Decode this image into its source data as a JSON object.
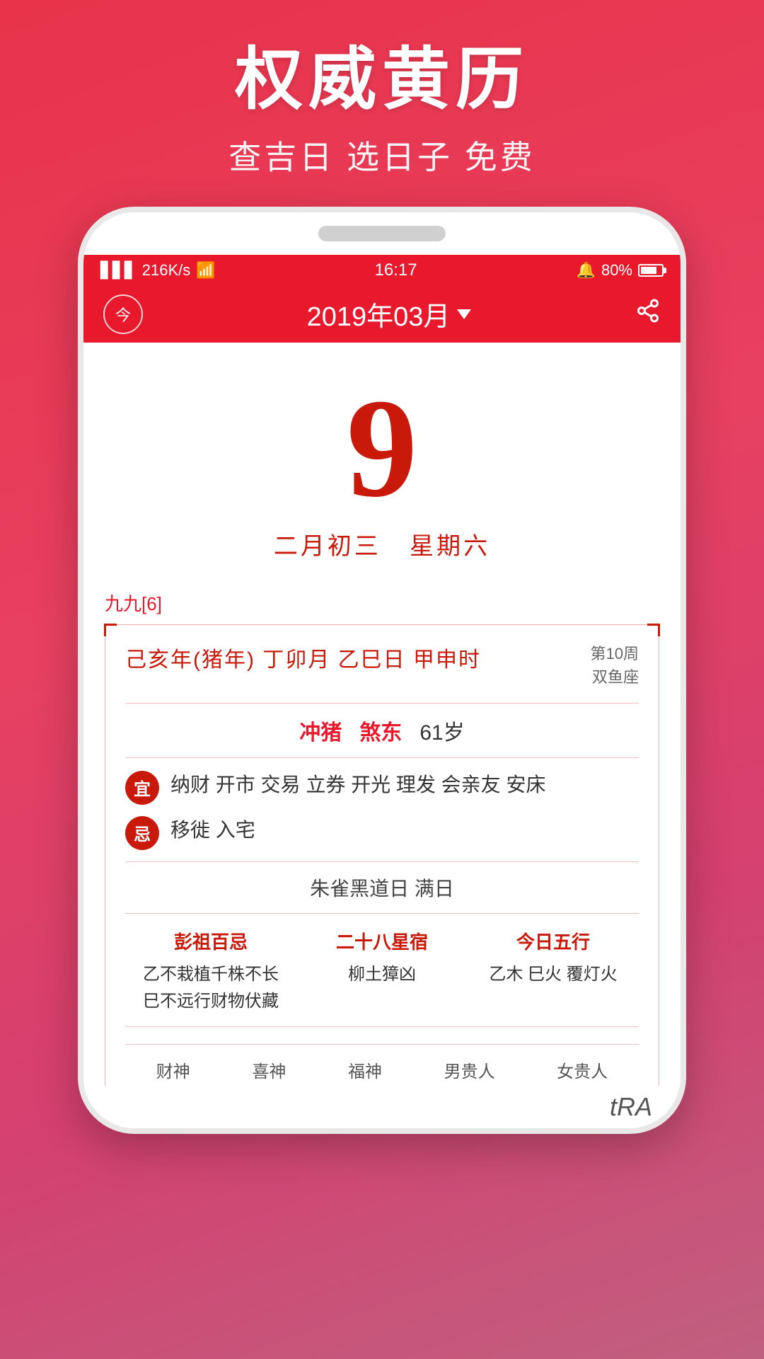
{
  "promo": {
    "title": "权威黄历",
    "subtitle": "查吉日 选日子 免费"
  },
  "status_bar": {
    "signal": "4G",
    "signal_speed": "216K/s",
    "wifi": "WiFi",
    "time": "16:17",
    "alarm": "🔔",
    "battery_pct": "80%"
  },
  "app_header": {
    "today_label": "今",
    "month_title": "2019年03月",
    "share_label": "⎙"
  },
  "main_date": {
    "day": "9",
    "lunar": "二月初三",
    "weekday": "星期六"
  },
  "detail": {
    "nine_nine": "九九[6]",
    "ganzhi_main": "己亥年(猪年) 丁卯月 乙巳日 甲申时",
    "ganzhi_week": "第10周",
    "ganzhi_zodiac": "双鱼座",
    "chong_label": "冲猪",
    "sha_label": "煞东",
    "age": "61岁",
    "yi_badge": "宜",
    "yi_text": "纳财 开市 交易 立券 开光 理发 会亲友 安床",
    "ji_badge": "忌",
    "ji_text": "移徙 入宅",
    "black_day": "朱雀黑道日   满日",
    "col1_title": "彭祖百忌",
    "col1_line1": "乙不栽植千株不长",
    "col1_line2": "巳不远行财物伏藏",
    "col2_title": "二十八星宿",
    "col2_text": "柳土獐凶",
    "col3_title": "今日五行",
    "col3_text": "乙木 巳火 覆灯火",
    "bottom_items": [
      "财神",
      "喜神",
      "福神",
      "男贵人",
      "女贵人"
    ]
  },
  "bottom_bar": {
    "tra_text": "tRA"
  }
}
